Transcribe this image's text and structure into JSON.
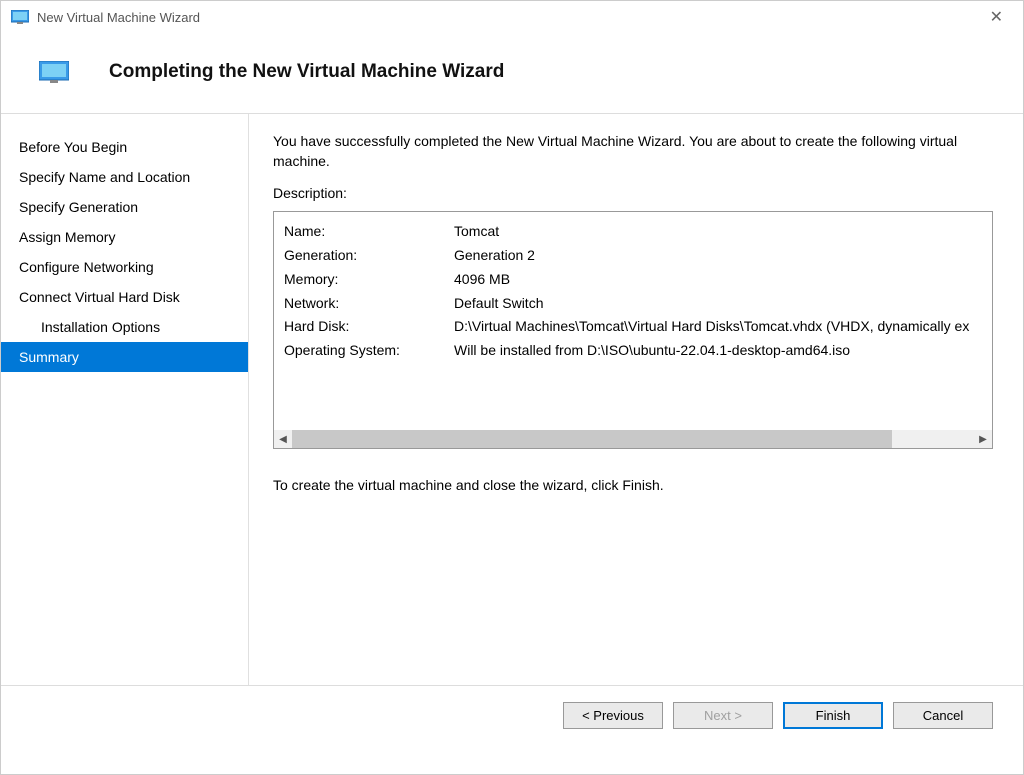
{
  "window": {
    "title": "New Virtual Machine Wizard"
  },
  "header": {
    "title": "Completing the New Virtual Machine Wizard"
  },
  "sidebar": {
    "items": [
      {
        "label": "Before You Begin",
        "selected": false,
        "indent": false
      },
      {
        "label": "Specify Name and Location",
        "selected": false,
        "indent": false
      },
      {
        "label": "Specify Generation",
        "selected": false,
        "indent": false
      },
      {
        "label": "Assign Memory",
        "selected": false,
        "indent": false
      },
      {
        "label": "Configure Networking",
        "selected": false,
        "indent": false
      },
      {
        "label": "Connect Virtual Hard Disk",
        "selected": false,
        "indent": false
      },
      {
        "label": "Installation Options",
        "selected": false,
        "indent": true
      },
      {
        "label": "Summary",
        "selected": true,
        "indent": false
      }
    ]
  },
  "content": {
    "intro": "You have successfully completed the New Virtual Machine Wizard. You are about to create the following virtual machine.",
    "description_label": "Description:",
    "fields": [
      {
        "key": "Name:",
        "value": "Tomcat"
      },
      {
        "key": "Generation:",
        "value": "Generation 2"
      },
      {
        "key": "Memory:",
        "value": "4096 MB"
      },
      {
        "key": "Network:",
        "value": "Default Switch"
      },
      {
        "key": "Hard Disk:",
        "value": "D:\\Virtual Machines\\Tomcat\\Virtual Hard Disks\\Tomcat.vhdx (VHDX, dynamically ex"
      },
      {
        "key": "Operating System:",
        "value": "Will be installed from D:\\ISO\\ubuntu-22.04.1-desktop-amd64.iso"
      }
    ],
    "hint": "To create the virtual machine and close the wizard, click Finish."
  },
  "buttons": {
    "previous": "< Previous",
    "next": "Next >",
    "finish": "Finish",
    "cancel": "Cancel"
  }
}
